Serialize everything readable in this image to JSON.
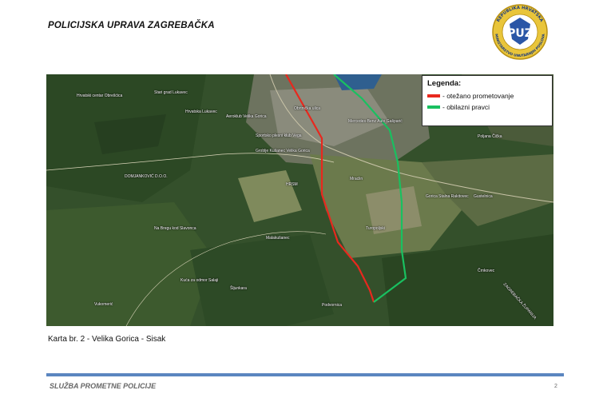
{
  "header": {
    "title": "POLICIJSKA UPRAVA ZAGREBAČKA"
  },
  "logo": {
    "ring_text_top": "REPUBLIKA HRVATSKA",
    "ring_text_bottom": "MINISTARSTVO UNUTARNJIH POSLOVA",
    "center_text": "PUZ",
    "colors": {
      "ring": "#e9c53a",
      "ring_border": "#b89012",
      "center": "#2a56a6"
    },
    "icon": "police-emblem-icon"
  },
  "map": {
    "legend": {
      "title": "Legenda:",
      "items": [
        {
          "label": "- otežano prometovanje",
          "color": "#e8281e"
        },
        {
          "label": "- obilazni pravci",
          "color": "#19c060"
        }
      ]
    },
    "labels": {
      "hrvatski": "Hrvatski centar Obrešćica",
      "stari_grad": "Stari grad Lukavec",
      "lukavec": "Hrvatska Lukavec",
      "aerodrom": "Aeroklub Velika Gorica",
      "sportsko": "Sportsko plesni klub Vega",
      "groblje": "Groblje Kušanec Velika Gorica",
      "rakitovec": "Gorica Stalna Rakitovec",
      "domjankovic": "DOMJANKOVIĆ D.O.O.",
      "malakusa": "Malakušanec",
      "bregu": "Na Bregu kod Slavonca",
      "kuca": "Kuća za odmor Salaji",
      "vukomeric": "Vukomerić",
      "poljana": "Poljana Čička",
      "gustelnica": "Gustelnica",
      "crnkovec": "Črnkovec",
      "turopoljski": "Turopoljski",
      "sljunkara": "Šljunkara",
      "podvornica": "Podvornica",
      "mercedes": "Mercedes-Benz Auto Gašparić",
      "obrtnicka": "Obrtnička ulica",
      "hrsm": "HRSM",
      "mraclin": "Mraclin",
      "zagrebacka": "ZAGREBAČKA ŽUPANIJA"
    }
  },
  "caption": "Karta br. 2  - Velika Gorica - Sisak",
  "footer": {
    "text": "SLUŽBA PROMETNE POLICIJE",
    "page_number": "2"
  }
}
